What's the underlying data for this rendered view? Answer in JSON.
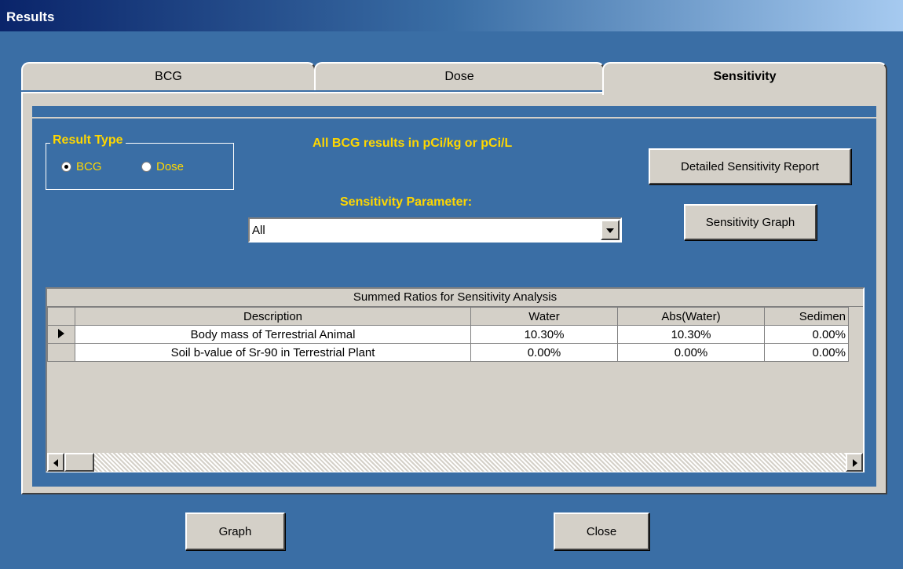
{
  "window": {
    "title": "Results"
  },
  "tabs": [
    {
      "label": "BCG"
    },
    {
      "label": "Dose"
    },
    {
      "label": "Sensitivity"
    }
  ],
  "result_type": {
    "title": "Result Type",
    "options": [
      {
        "label": "BCG",
        "checked": true
      },
      {
        "label": "Dose",
        "checked": false
      }
    ]
  },
  "units_note": "All BCG results in pCi/kg or pCi/L",
  "sensitivity_parameter": {
    "label": "Sensitivity Parameter:",
    "value": "All"
  },
  "buttons": {
    "detailed_report": "Detailed Sensitivity Report",
    "sensitivity_graph": "Sensitivity Graph",
    "graph": "Graph",
    "close": "Close"
  },
  "grid": {
    "caption": "Summed Ratios for Sensitivity Analysis",
    "columns": [
      "Description",
      "Water",
      "Abs(Water)",
      "Sedimen"
    ],
    "rows": [
      {
        "description": "Body mass of Terrestrial Animal",
        "water": "10.30%",
        "abs_water": "10.30%",
        "sediment": "0.00%"
      },
      {
        "description": "Soil b-value of Sr-90 in Terrestrial Plant",
        "water": "0.00%",
        "abs_water": "0.00%",
        "sediment": "0.00%"
      }
    ]
  }
}
